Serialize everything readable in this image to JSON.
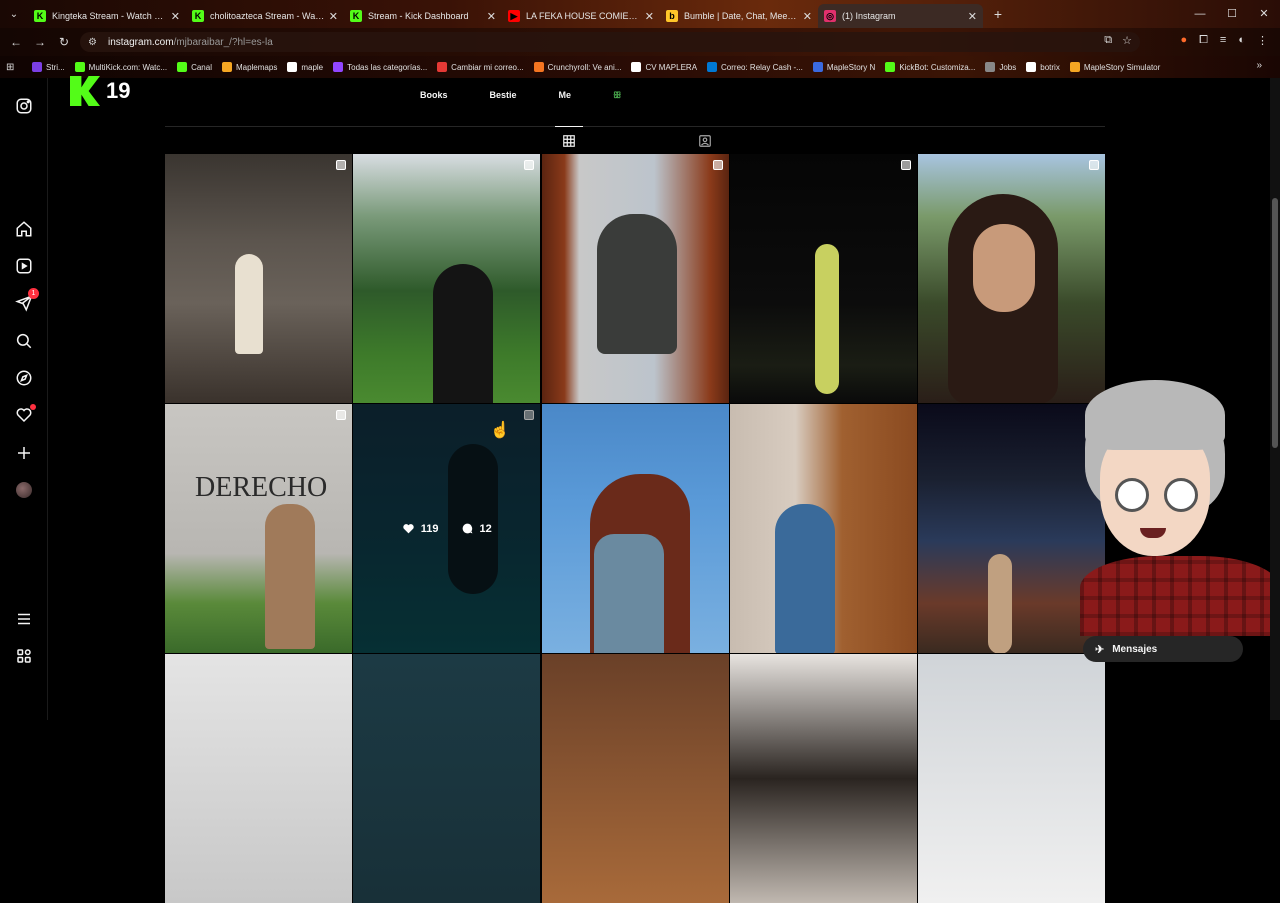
{
  "browser": {
    "tabs": [
      {
        "title": "Kingteka Stream - Watch Live o",
        "fav_color": "#53fc18",
        "fav": "K",
        "active": false
      },
      {
        "title": "cholitoazteca Stream - Watch l",
        "fav_color": "#53fc18",
        "fav": "K",
        "active": false
      },
      {
        "title": "Stream - Kick Dashboard",
        "fav_color": "#53fc18",
        "fav": "K",
        "active": false
      },
      {
        "title": "LA FEKA HOUSE COMIENZA",
        "fav_color": "#ff0000",
        "fav": "▶",
        "active": false
      },
      {
        "title": "Bumble | Date, Chat, Meet New",
        "fav_color": "#ffc629",
        "fav": "b",
        "active": false
      },
      {
        "title": "(1) Instagram",
        "fav_color": "#e1306c",
        "fav": "◎",
        "active": true
      }
    ],
    "url_host": "instagram.com",
    "url_path": "/mjbaraibar_/?hl=es-la",
    "bookmarks": [
      {
        "label": "Stri...",
        "color": "#7b3fe4"
      },
      {
        "label": "MultiKick.com: Watc...",
        "color": "#53fc18"
      },
      {
        "label": "Canal",
        "color": "#53fc18"
      },
      {
        "label": "Maplemaps",
        "color": "#f5a623"
      },
      {
        "label": "maple",
        "color": "#ffffff"
      },
      {
        "label": "Todas las categorías...",
        "color": "#9146ff"
      },
      {
        "label": "Cambiar mi correo...",
        "color": "#e53935"
      },
      {
        "label": "Crunchyroll: Ve ani...",
        "color": "#f47521"
      },
      {
        "label": "CV MAPLERA",
        "color": "#ffffff"
      },
      {
        "label": "Correo: Relay Cash -...",
        "color": "#0078d4"
      },
      {
        "label": "MapleStory N",
        "color": "#3a6ae0"
      },
      {
        "label": "KickBot: Customiza...",
        "color": "#53fc18"
      },
      {
        "label": "Jobs",
        "color": "#888888"
      },
      {
        "label": "botrix",
        "color": "#ffffff"
      },
      {
        "label": "MapleStory Simulator",
        "color": "#f5a623"
      }
    ]
  },
  "kick_overlay": {
    "viewers": "19",
    "brand_color": "#53fc18"
  },
  "profile": {
    "highlights": [
      "Books",
      "Bestie",
      "Me",
      "ꕥ"
    ],
    "hovered_post": {
      "likes": "119",
      "comments": "12"
    },
    "post_text": "DERECHO"
  },
  "nav_icons": [
    "instagram-icon",
    "home-icon",
    "reels-icon",
    "send-icon",
    "search-icon",
    "explore-icon",
    "heart-icon",
    "create-icon",
    "profile-avatar",
    "menu-icon",
    "threads-icon"
  ],
  "notifications": {
    "messages_badge": "1"
  },
  "messages_pill": {
    "label": "Mensajes"
  }
}
